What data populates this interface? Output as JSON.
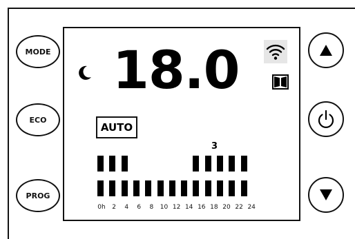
{
  "buttons": {
    "mode": "MODE",
    "eco": "ECO",
    "prog": "PROG"
  },
  "display": {
    "temperature": "18.0",
    "mode_badge": "AUTO",
    "current_hour_marker": "3",
    "hour_labels": [
      "0h",
      "2",
      "4",
      "6",
      "8",
      "10",
      "12",
      "14",
      "16",
      "18",
      "20",
      "22",
      "24"
    ],
    "comfort_levels": [
      1,
      1,
      1,
      0,
      0,
      0,
      0,
      0,
      1,
      1,
      1,
      1,
      1
    ],
    "base_levels": [
      1,
      1,
      1,
      1,
      1,
      1,
      1,
      1,
      1,
      1,
      1,
      1,
      1
    ]
  },
  "icons": {
    "moon": "moon-icon",
    "wifi": "wifi-icon",
    "window": "window-icon",
    "up": "up-arrow-icon",
    "power": "power-icon",
    "down": "down-arrow-icon"
  }
}
